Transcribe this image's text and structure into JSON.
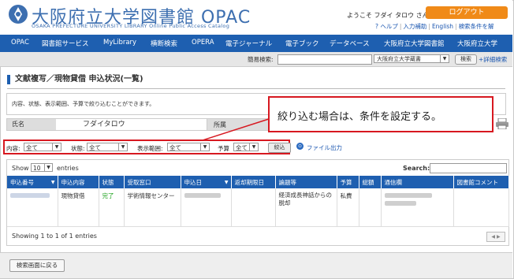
{
  "header": {
    "brand": "大阪府立大学図書館 OPAC",
    "brand_sub": "OSAKA PREFECTURE UNIVERSITY LIBRARY  Online Public Access Catalog",
    "welcome": "ようこそ フダイ タロウ さん",
    "logout_label": "ログアウト",
    "links": [
      "? ヘルプ",
      "入力補助",
      "English",
      "検索条件を解"
    ]
  },
  "nav": {
    "items": [
      "OPAC",
      "図書館サービス",
      "MyLibrary",
      "横断検索",
      "OPERA",
      "電子ジャーナル",
      "電子ブック",
      "データベース",
      "大阪府立大学図書館",
      "大阪府立大学"
    ]
  },
  "quick_search": {
    "label": "簡易検索:",
    "value": "",
    "scope": "大阪府立大学蔵書",
    "button": "検索",
    "advanced": "+詳細検索"
  },
  "page": {
    "title": "文献複写／現物貸借 申込状況(一覧)",
    "info": "内容、状態、表示範囲、予算で絞り込むことができます。",
    "name_label": "氏名",
    "name_value": "フダイタロウ",
    "dept_label": "所属"
  },
  "callout": {
    "text": "絞り込む場合は、条件を設定する。",
    "color": "#d71820"
  },
  "filter": {
    "content_label": "内容:",
    "content_value": "全て",
    "status_label": "状態:",
    "status_value": "全て",
    "range_label": "表示範囲:",
    "range_value": "全て",
    "budget_label": "予算",
    "budget_value": "全て",
    "button": "絞込",
    "file_output": "ファイル出力"
  },
  "table": {
    "show_label": "Show",
    "length_value": "10",
    "entries_label": "entries",
    "search_label": "Search:",
    "search_value": "",
    "columns": [
      "申込番号",
      "申込内容",
      "状態",
      "受取窓口",
      "申込日",
      "返却期限日",
      "論題等",
      "予算",
      "総額",
      "通信欄",
      "図書館コメント"
    ],
    "rows": [
      {
        "id": "",
        "content": "現物貸借",
        "status": "完了",
        "pickup": "学術情報センター",
        "date": "",
        "due": "",
        "title": "経済成長神話からの脱却",
        "budget": "私費",
        "total": "",
        "comm": "",
        "comment": ""
      }
    ],
    "showing": "Showing 1 to 1 of 1 entries"
  },
  "footer": {
    "back_button": "検索画面に戻る"
  },
  "colors": {
    "brand": "#3d6fb0",
    "nav": "#1e5fb0",
    "logout": "#f08a18",
    "highlight": "#d71820",
    "status_done": "#1aa11a"
  }
}
